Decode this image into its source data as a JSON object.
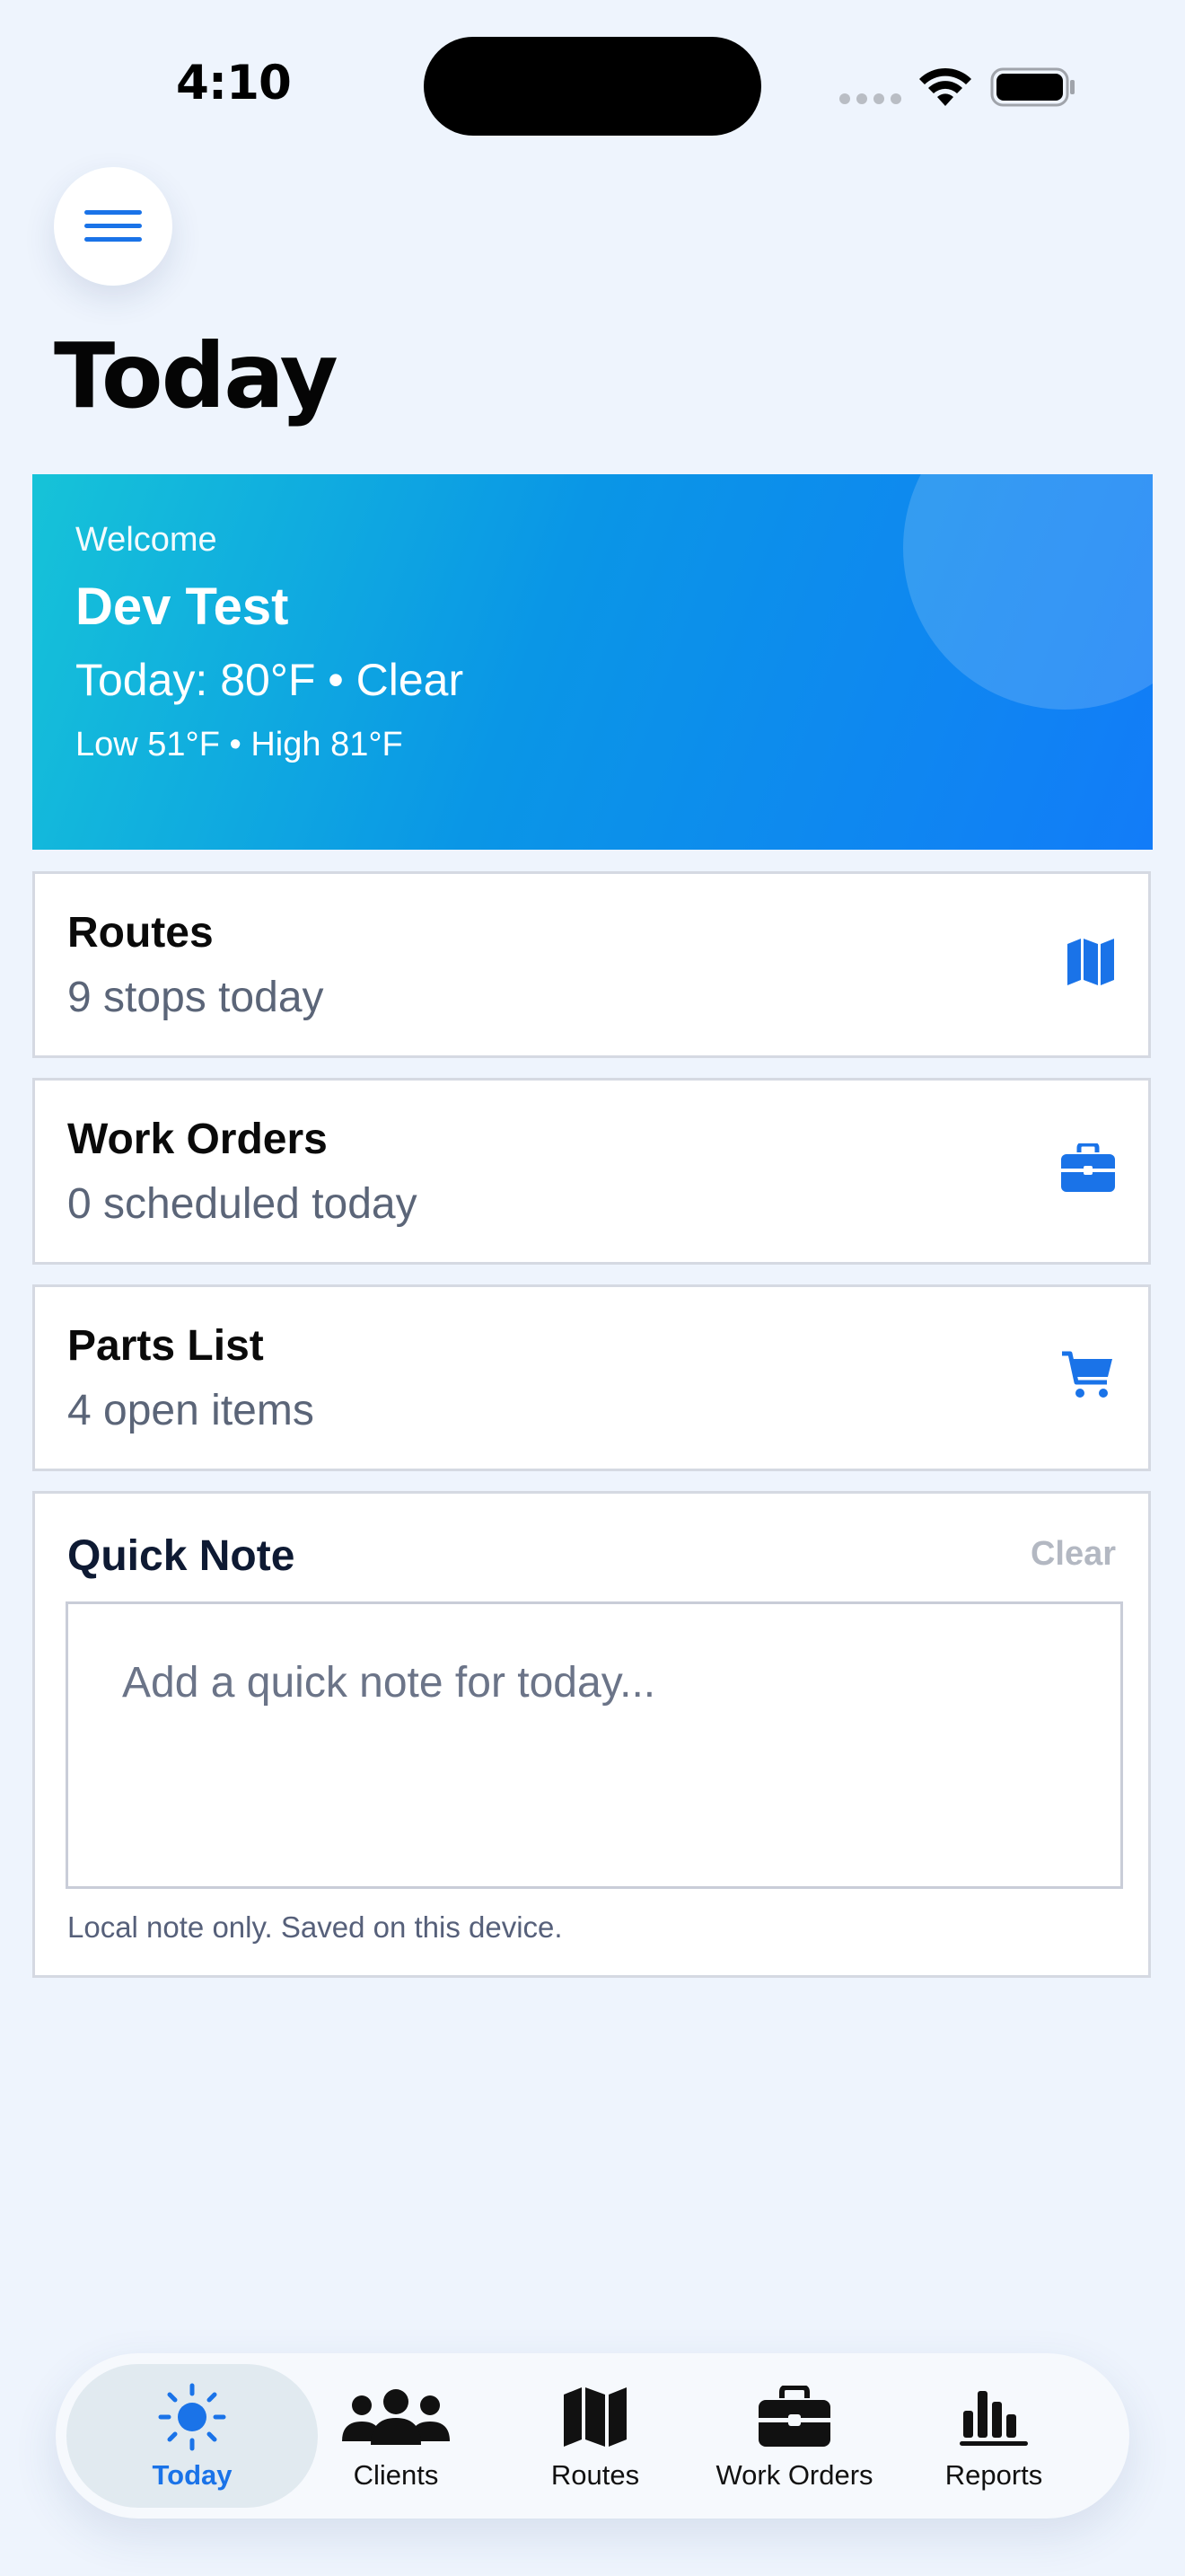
{
  "status_bar": {
    "time": "4:10"
  },
  "header": {
    "title": "Today"
  },
  "welcome": {
    "label": "Welcome",
    "name": "Dev Test",
    "weather": "Today: 80°F • Clear",
    "range": "Low 51°F • High 81°F"
  },
  "cards": [
    {
      "title": "Routes",
      "subtitle": "9 stops today",
      "icon": "map-icon"
    },
    {
      "title": "Work Orders",
      "subtitle": "0 scheduled today",
      "icon": "briefcase-icon"
    },
    {
      "title": "Parts List",
      "subtitle": "4 open items",
      "icon": "cart-icon"
    }
  ],
  "quick_note": {
    "title": "Quick Note",
    "clear_label": "Clear",
    "placeholder": "Add a quick note for today...",
    "value": "",
    "footer": "Local note only. Saved on this device."
  },
  "tabs": [
    {
      "label": "Today",
      "icon": "sun-icon",
      "active": true
    },
    {
      "label": "Clients",
      "icon": "people-icon",
      "active": false
    },
    {
      "label": "Routes",
      "icon": "map-icon",
      "active": false
    },
    {
      "label": "Work Orders",
      "icon": "briefcase-icon",
      "active": false
    },
    {
      "label": "Reports",
      "icon": "chart-icon",
      "active": false
    }
  ],
  "colors": {
    "background": "#EEF4FD",
    "accent": "#1A73E8",
    "gradient_start": "#16C3D8",
    "gradient_end": "#127CF8"
  }
}
